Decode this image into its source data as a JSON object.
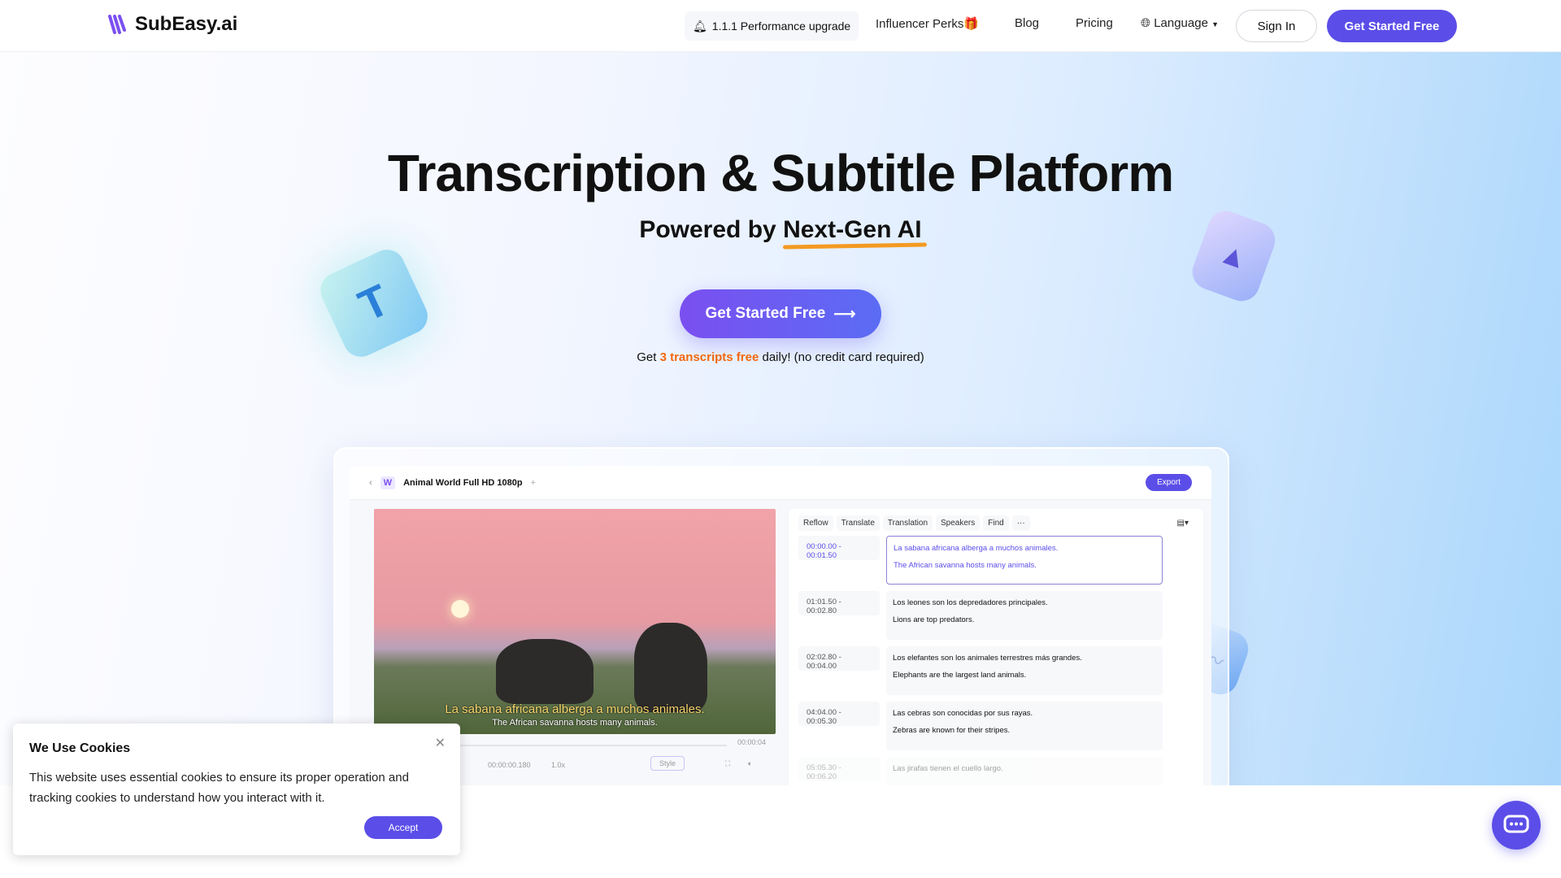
{
  "nav": {
    "brand": "SubEasy.ai",
    "performance": "1.1.1 Performance upgrade",
    "influencer": "Influencer Perks",
    "blog": "Blog",
    "pricing": "Pricing",
    "language": "Language",
    "sign_in": "Sign In",
    "get_started": "Get Started Free"
  },
  "hero": {
    "title": "Transcription & Subtitle Platform",
    "subtitle_prefix": "Powered by",
    "subtitle_highlight": "Next-Gen AI",
    "cta": "Get Started Free",
    "note_prefix": "Get",
    "note_highlight": "3 transcripts free",
    "note_suffix": "daily! (no credit card required)"
  },
  "editor": {
    "file_name": "Animal World Full HD 1080p",
    "export": "Export",
    "video": {
      "subtitle_es": "La sabana africana alberga a muchos animales.",
      "subtitle_en": "The African savanna hosts many animals.",
      "duration": "00:00:04",
      "current": "00:00:00.180",
      "speed": "1.0x",
      "style": "Style"
    },
    "tools": [
      "Reflow",
      "Translate",
      "Translation",
      "Speakers",
      "Find",
      "···"
    ],
    "segments": [
      {
        "time": "00:00.00 - 00:01.50",
        "es": "La sabana africana alberga a muchos animales.",
        "en": "The African savanna hosts many animals."
      },
      {
        "time": "01:01.50 - 00:02.80",
        "es": "Los leones son los depredadores principales.",
        "en": "Lions are top predators."
      },
      {
        "time": "02:02.80 - 00:04.00",
        "es": "Los elefantes son los animales terrestres más grandes.",
        "en": "Elephants are the largest land animals."
      },
      {
        "time": "04:04.00 - 00:05.30",
        "es": "Las cebras son conocidas por sus rayas.",
        "en": "Zebras are known for their stripes."
      },
      {
        "time": "05:05.30 - 00:06.20",
        "es": "Las jirafas tienen el cuello largo.",
        "en": ""
      }
    ]
  },
  "cookie": {
    "title": "We Use Cookies",
    "body": "This website uses essential cookies to ensure its proper operation and tracking cookies to understand how you interact with it.",
    "accept": "Accept"
  },
  "colors": {
    "accent": "#5b4ee8",
    "highlight": "#f2690f"
  }
}
